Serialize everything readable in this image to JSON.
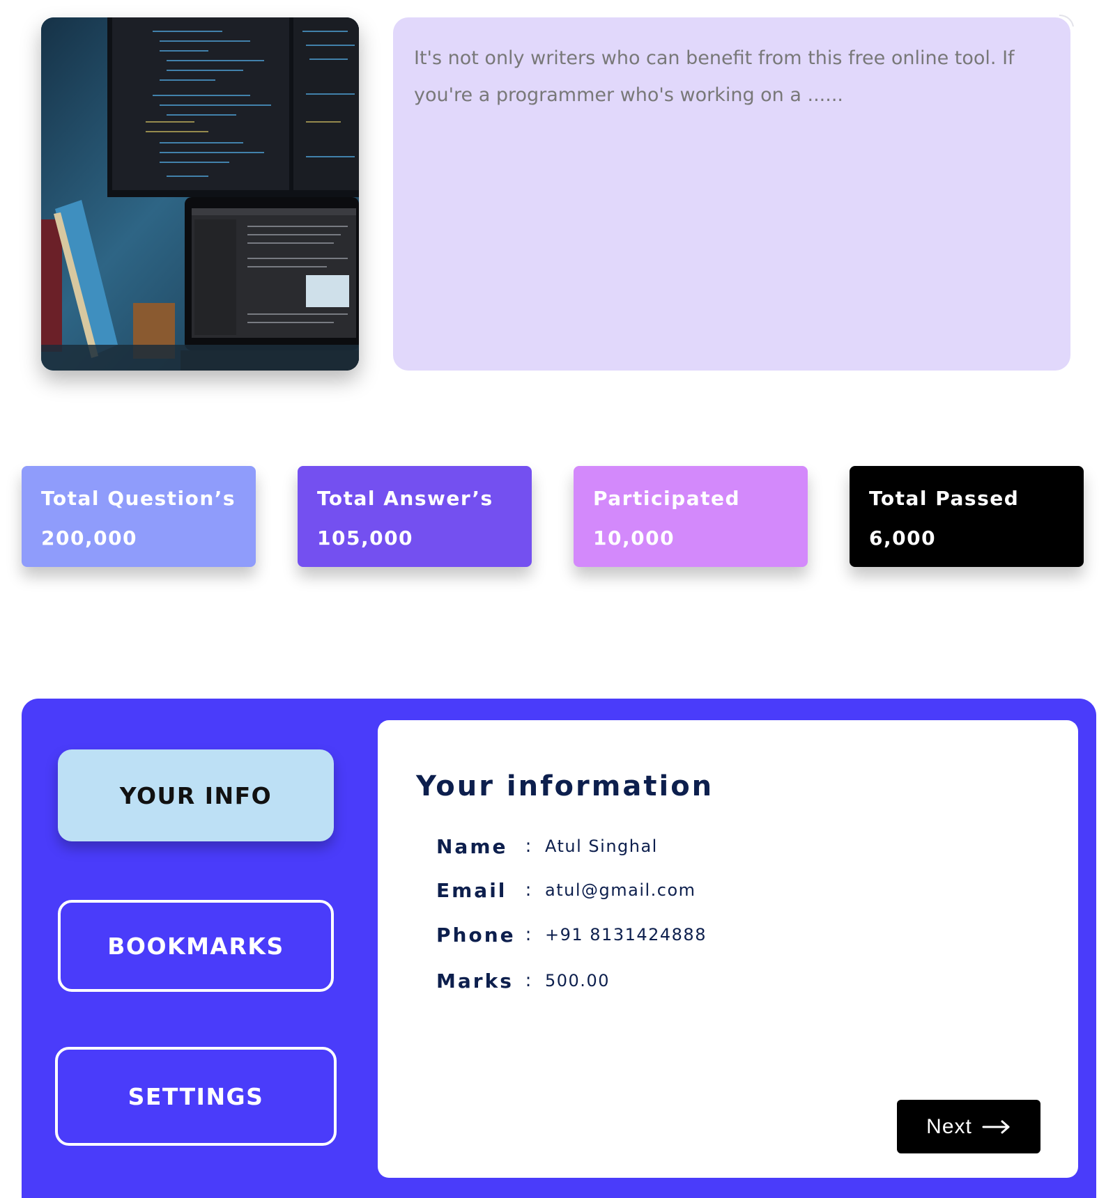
{
  "hero": {
    "image_alt": "monitor-and-laptop-with-code-icon"
  },
  "description": {
    "text": "It's not only writers who can benefit from this free online tool. If you're a programmer who's working on a ......"
  },
  "stats": [
    {
      "label": "Total Question’s",
      "value": "200,000",
      "color": "#8f9cfb"
    },
    {
      "label": "Total Answer’s",
      "value": "105,000",
      "color": "#7450f0"
    },
    {
      "label": "Participated",
      "value": "10,000",
      "color": "#d389fb"
    },
    {
      "label": "Total Passed",
      "value": "6,000",
      "color": "#000000"
    }
  ],
  "nav": {
    "your_info": "YOUR INFO",
    "bookmarks": "BOOKMARKS",
    "settings": "SETTINGS"
  },
  "info": {
    "title": "Your information",
    "separator": ":",
    "rows": [
      {
        "key": "Name",
        "value": "Atul Singhal"
      },
      {
        "key": "Email",
        "value": "atul@gmail.com"
      },
      {
        "key": "Phone",
        "value": "+91 8131424888"
      },
      {
        "key": "Marks",
        "value": "500.00"
      }
    ],
    "next_label": "Next"
  },
  "colors": {
    "panel_bg": "#4a3cfa",
    "desc_bg": "#e1d8fb",
    "active_tab_bg": "#bde0f5",
    "text_navy": "#0d1f4d"
  }
}
